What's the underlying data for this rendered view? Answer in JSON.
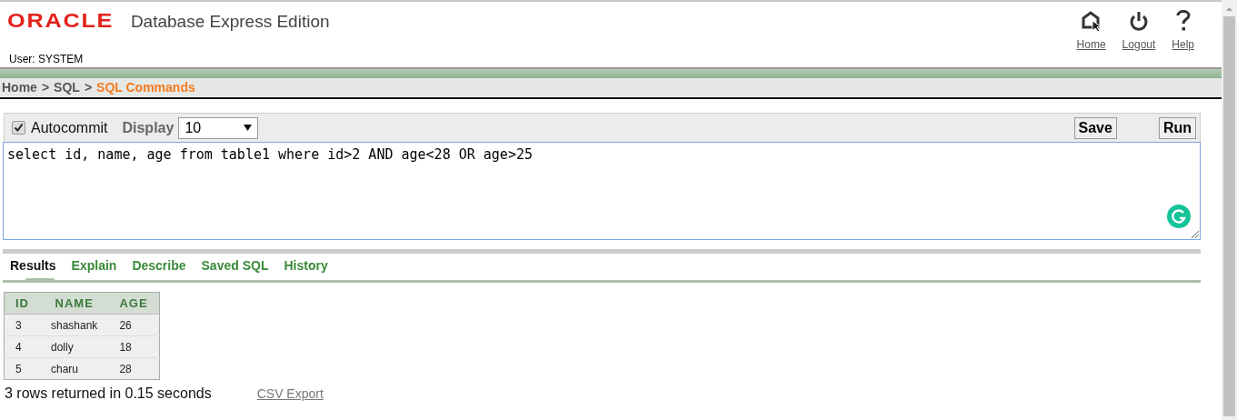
{
  "header": {
    "logo": "ORACLE",
    "product": "Database Express Edition",
    "user": "User: SYSTEM",
    "links": [
      {
        "label": "Home",
        "kind": "home"
      },
      {
        "label": "Logout",
        "kind": "logout"
      },
      {
        "label": "Help",
        "kind": "help"
      }
    ]
  },
  "breadcrumb": [
    {
      "label": "Home",
      "kind": "link"
    },
    {
      "label": ">",
      "kind": "separator"
    },
    {
      "label": "SQL",
      "kind": "link"
    },
    {
      "label": ">",
      "kind": "separator"
    },
    {
      "label": "SQL Commands",
      "kind": "current"
    }
  ],
  "toolbar": {
    "autocommit": {
      "label": "Autocommit",
      "checked": true
    },
    "display": {
      "label": "Display",
      "value": "10"
    },
    "buttons": [
      "Save",
      "Run"
    ]
  },
  "editor": {
    "value": "select id, name, age from table1 where id>2 AND age<28 OR age>25"
  },
  "tabs": [
    {
      "label": "Results",
      "selected": true
    },
    {
      "label": "Explain",
      "selected": false
    },
    {
      "label": "Describe",
      "selected": false
    },
    {
      "label": "Saved SQL",
      "selected": false
    },
    {
      "label": "History",
      "selected": false
    }
  ],
  "table": {
    "columns": [
      "ID",
      "NAME",
      "AGE"
    ],
    "rows": [
      [
        "3",
        "shashank",
        "26"
      ],
      [
        "4",
        "dolly",
        "18"
      ],
      [
        "5",
        "charu",
        "28"
      ]
    ]
  },
  "footer": {
    "summary": "3 rows returned in 0.15 seconds",
    "export": "CSV Export"
  }
}
